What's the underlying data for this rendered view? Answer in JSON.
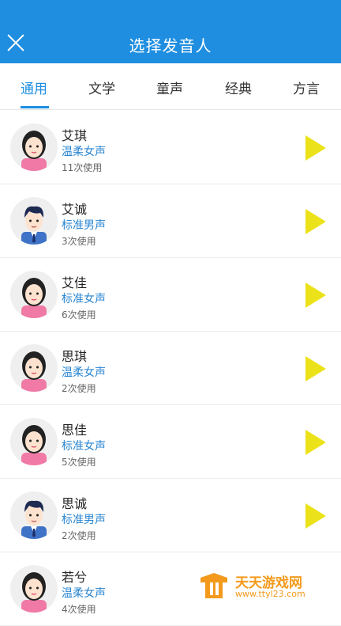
{
  "header": {
    "title": "选择发音人"
  },
  "tabs": [
    {
      "label": "通用",
      "active": true
    },
    {
      "label": "文学"
    },
    {
      "label": "童声"
    },
    {
      "label": "经典"
    },
    {
      "label": "方言"
    }
  ],
  "voices": [
    {
      "name": "艾琪",
      "type": "温柔女声",
      "usage": "11次使用",
      "gender": "female"
    },
    {
      "name": "艾诚",
      "type": "标准男声",
      "usage": "3次使用",
      "gender": "male"
    },
    {
      "name": "艾佳",
      "type": "标准女声",
      "usage": "6次使用",
      "gender": "female"
    },
    {
      "name": "思琪",
      "type": "温柔女声",
      "usage": "2次使用",
      "gender": "female"
    },
    {
      "name": "思佳",
      "type": "标准女声",
      "usage": "5次使用",
      "gender": "female"
    },
    {
      "name": "思诚",
      "type": "标准男声",
      "usage": "2次使用",
      "gender": "male"
    },
    {
      "name": "若兮",
      "type": "温柔女声",
      "usage": "4次使用",
      "gender": "female"
    }
  ],
  "watermark": {
    "title": "天天游戏网",
    "url": "www.ttyl23.com"
  },
  "colors": {
    "primary": "#1f8ee0",
    "play": "#ece21a",
    "voice_type": "#2a86d1"
  }
}
